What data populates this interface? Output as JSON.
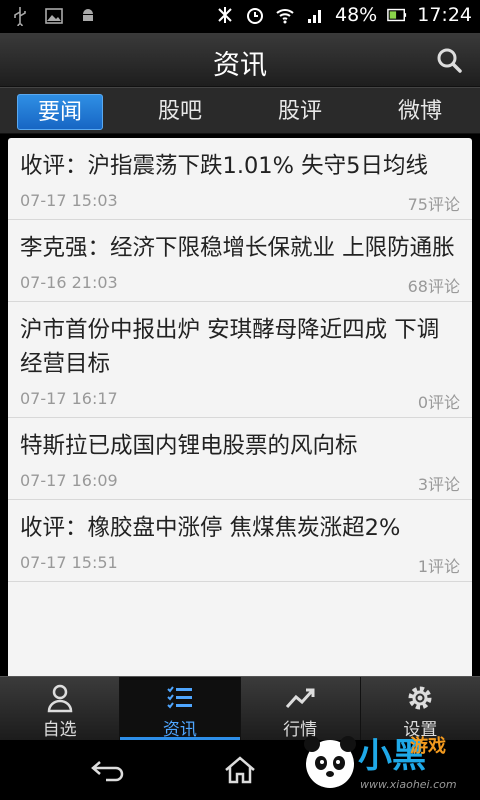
{
  "status": {
    "battery": "48%",
    "time": "17:24"
  },
  "header": {
    "title": "资讯"
  },
  "tabs": [
    {
      "label": "要闻",
      "active": true
    },
    {
      "label": "股吧",
      "active": false
    },
    {
      "label": "股评",
      "active": false
    },
    {
      "label": "微博",
      "active": false
    }
  ],
  "news": [
    {
      "title": "收评：沪指震荡下跌1.01% 失守5日均线",
      "date": "07-17  15:03",
      "comments": "75评论"
    },
    {
      "title": "李克强：经济下限稳增长保就业 上限防通胀",
      "date": "07-16  21:03",
      "comments": "68评论"
    },
    {
      "title": "沪市首份中报出炉 安琪酵母降近四成 下调经营目标",
      "date": "07-17  16:17",
      "comments": "0评论"
    },
    {
      "title": "特斯拉已成国内锂电股票的风向标",
      "date": "07-17  16:09",
      "comments": "3评论"
    },
    {
      "title": "收评：橡胶盘中涨停 焦煤焦炭涨超2%",
      "date": "07-17  15:51",
      "comments": "1评论"
    }
  ],
  "bottom_nav": [
    {
      "label": "自选",
      "icon": "person-icon"
    },
    {
      "label": "资讯",
      "icon": "news-list-icon",
      "active": true
    },
    {
      "label": "行情",
      "icon": "trend-chart-icon"
    },
    {
      "label": "设置",
      "icon": "gear-icon"
    }
  ],
  "watermark": {
    "text": "小黑",
    "sub": "游戏",
    "url": "www.xiaohei.com"
  },
  "colors": {
    "accent": "#1a73d0",
    "active_nav": "#4fa6ff"
  }
}
